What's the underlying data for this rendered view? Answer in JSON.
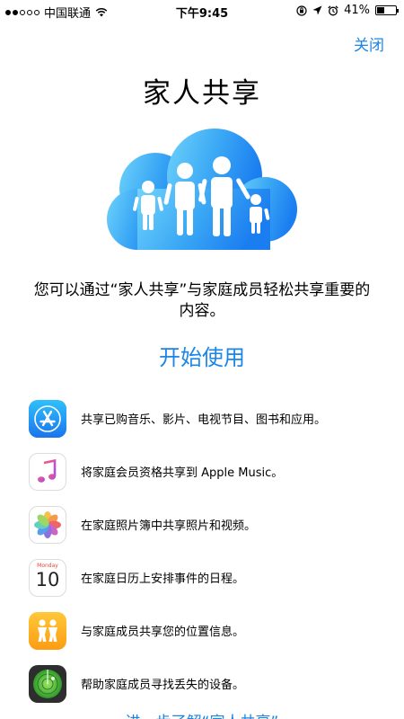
{
  "status_bar": {
    "carrier": "中国联通",
    "time": "下午9:45",
    "battery_percent": "41%",
    "battery_level": 0.41,
    "signal_dots_filled": 2,
    "signal_dots_total": 5,
    "icons": [
      "wifi-icon",
      "lock-rotation-icon",
      "location-icon",
      "alarm-icon",
      "battery-icon"
    ]
  },
  "header": {
    "close_label": "关闭"
  },
  "page": {
    "title": "家人共享",
    "description": "您可以通过“家人共享”与家庭成员轻松共享重要的内容。",
    "start_label": "开始使用",
    "more_label": "进一步了解“家人共享”"
  },
  "features": [
    {
      "icon": "app-store-icon",
      "text": "共享已购音乐、影片、电视节目、图书和应用。"
    },
    {
      "icon": "apple-music-icon",
      "text": "将家庭会员资格共享到 Apple Music。"
    },
    {
      "icon": "photos-icon",
      "text": "在家庭照片簿中共享照片和视频。"
    },
    {
      "icon": "calendar-icon",
      "text": "在家庭日历上安排事件的日程。",
      "calendar_day": "Monday",
      "calendar_date": "10"
    },
    {
      "icon": "find-my-friends-icon",
      "text": "与家庭成员共享您的位置信息。"
    },
    {
      "icon": "find-my-iphone-icon",
      "text": "帮助家庭成员寻找丢失的设备。"
    }
  ],
  "colors": {
    "accent": "#1b86e8",
    "cloud_light": "#5ec9f8",
    "cloud_dark": "#1b7ef0"
  }
}
